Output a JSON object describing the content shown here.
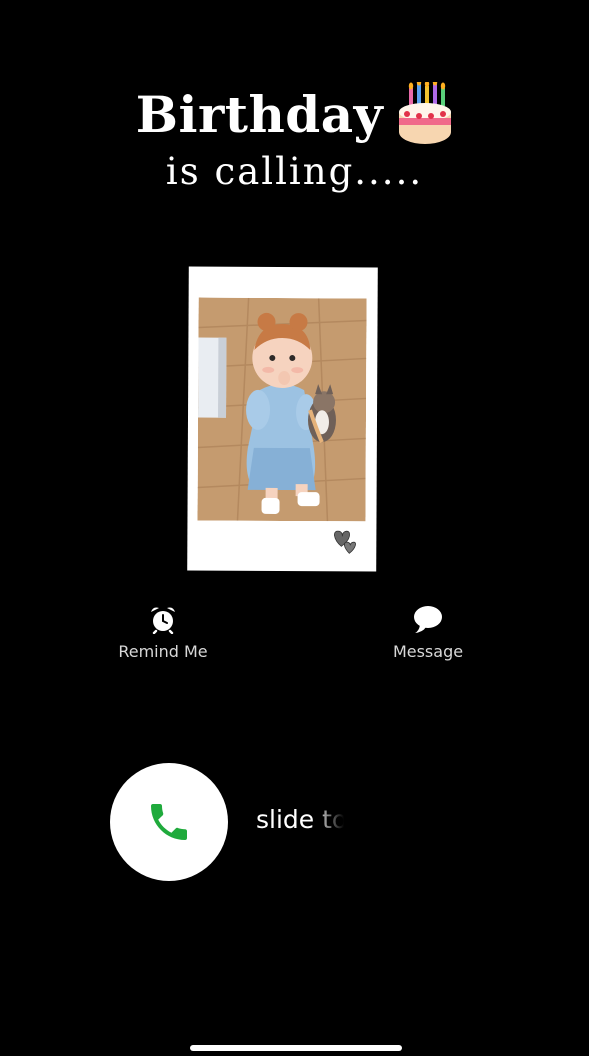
{
  "caller": {
    "name": "Birthday",
    "status": "is calling....."
  },
  "actions": {
    "remind_label": "Remind Me",
    "message_label": "Message"
  },
  "slider": {
    "text": "slide to"
  },
  "icons": {
    "cake": "birthday-cake-emoji",
    "alarm": "alarm-clock-icon",
    "message": "speech-bubble-icon",
    "phone": "phone-handset-icon",
    "hearts": "doodle-hearts-icon"
  },
  "colors": {
    "background": "#000000",
    "text": "#ffffff",
    "action_text": "#d8d8d8",
    "call_button": "#ffffff",
    "phone_icon": "#1faa3c"
  }
}
